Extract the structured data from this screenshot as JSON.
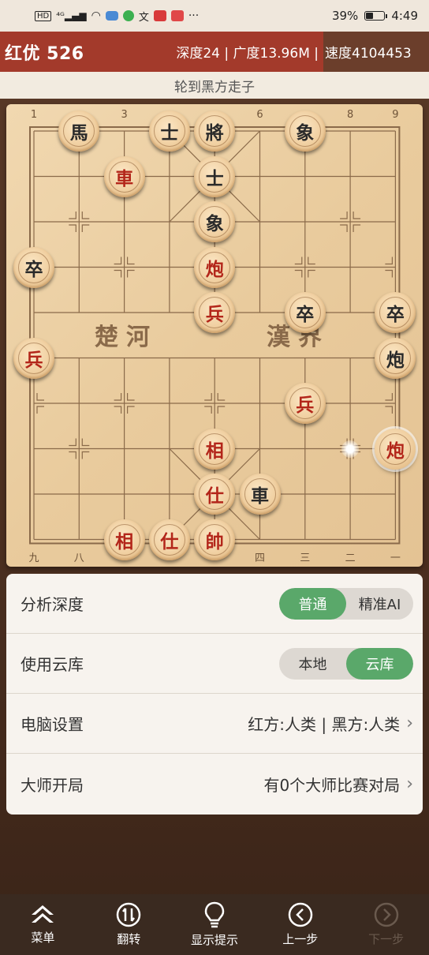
{
  "status_bar": {
    "icons": [
      "HD",
      "4G",
      "signal-icon",
      "wifi-icon",
      "cloud-icon",
      "app-icon",
      "translate-icon",
      "app-icon",
      "app-icon",
      "more-icon"
    ],
    "battery_percent": "39%",
    "battery_level": 0.39,
    "time": "4:49"
  },
  "info_bar": {
    "title": "红优 526",
    "stats": "深度24 | 广度13.96M |",
    "speed": "速度4104453"
  },
  "turn_text": "轮到黑方走子",
  "board": {
    "top_numbers": [
      "1",
      "3",
      "6",
      "8",
      "9"
    ],
    "bottom_numbers": [
      "九",
      "八",
      "四",
      "三",
      "二",
      "一"
    ],
    "river_left": "楚河",
    "river_right": "漢界",
    "pieces": [
      {
        "char": "馬",
        "side": "black",
        "file": 1,
        "rank": 0
      },
      {
        "char": "士",
        "side": "black",
        "file": 3,
        "rank": 0
      },
      {
        "char": "將",
        "side": "black",
        "file": 4,
        "rank": 0
      },
      {
        "char": "象",
        "side": "black",
        "file": 6,
        "rank": 0
      },
      {
        "char": "車",
        "side": "red",
        "file": 2,
        "rank": 1
      },
      {
        "char": "士",
        "side": "black",
        "file": 4,
        "rank": 1
      },
      {
        "char": "象",
        "side": "black",
        "file": 4,
        "rank": 2
      },
      {
        "char": "卒",
        "side": "black",
        "file": 0,
        "rank": 3
      },
      {
        "char": "炮",
        "side": "red",
        "file": 4,
        "rank": 3
      },
      {
        "char": "兵",
        "side": "red",
        "file": 4,
        "rank": 4
      },
      {
        "char": "卒",
        "side": "black",
        "file": 6,
        "rank": 4
      },
      {
        "char": "卒",
        "side": "black",
        "file": 8,
        "rank": 4
      },
      {
        "char": "兵",
        "side": "red",
        "file": 0,
        "rank": 5
      },
      {
        "char": "炮",
        "side": "black",
        "file": 8,
        "rank": 5
      },
      {
        "char": "兵",
        "side": "red",
        "file": 6,
        "rank": 6
      },
      {
        "char": "炮",
        "side": "red",
        "file": 8,
        "rank": 7,
        "selected": true
      },
      {
        "char": "相",
        "side": "red",
        "file": 4,
        "rank": 7
      },
      {
        "char": "仕",
        "side": "red",
        "file": 4,
        "rank": 8
      },
      {
        "char": "車",
        "side": "black",
        "file": 5,
        "rank": 8
      },
      {
        "char": "相",
        "side": "red",
        "file": 2,
        "rank": 9
      },
      {
        "char": "仕",
        "side": "red",
        "file": 3,
        "rank": 9
      },
      {
        "char": "帥",
        "side": "red",
        "file": 4,
        "rank": 9
      }
    ],
    "move_dot": {
      "file": 7,
      "rank": 7
    }
  },
  "settings": {
    "depth": {
      "label": "分析深度",
      "options": [
        "普通",
        "精准AI"
      ],
      "selected": 0
    },
    "cloud": {
      "label": "使用云库",
      "options": [
        "本地",
        "云库"
      ],
      "selected": 1
    },
    "computer": {
      "label": "电脑设置",
      "value": "红方:人类 | 黑方:人类"
    },
    "master": {
      "label": "大师开局",
      "value": "有0个大师比赛对局"
    }
  },
  "nav": {
    "menu": "菜单",
    "flip": "翻转",
    "hint": "显示提示",
    "prev": "上一步",
    "next": "下一步"
  },
  "colors": {
    "red_bar": "#a33a2b",
    "accent_green": "#5aa86a",
    "red_piece_text": "#b3261a",
    "black_piece_text": "#2a2a2a"
  }
}
